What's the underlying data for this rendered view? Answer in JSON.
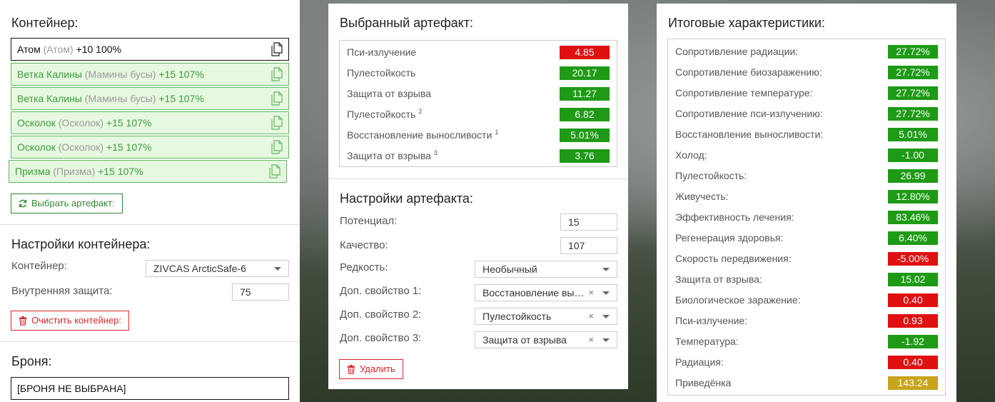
{
  "container_panel": {
    "title": "Контейнер:",
    "items": [
      {
        "name": "Атом",
        "alt": "(Атом)",
        "level": "+10 100%",
        "selected": false
      },
      {
        "name": "Ветка Калины",
        "alt": "(Мамины бусы)",
        "level": "+15 107%",
        "selected": true
      },
      {
        "name": "Ветка Калины",
        "alt": "(Мамины бусы)",
        "level": "+15 107%",
        "selected": true
      },
      {
        "name": "Осколок",
        "alt": "(Осколок)",
        "level": "+15 107%",
        "selected": true
      },
      {
        "name": "Осколок",
        "alt": "(Осколок)",
        "level": "+15 107%",
        "selected": true
      },
      {
        "name": "Призма",
        "alt": "(Призма)",
        "level": "+15 107%",
        "selected": true
      }
    ],
    "select_button": "Выбрать артефакт:",
    "settings_title": "Настройки контейнера:",
    "container_label": "Контейнер:",
    "container_value": "ZIVCAS ArcticSafe-6",
    "inner_protection_label": "Внутренняя защита:",
    "inner_protection_value": "75",
    "clear_button": "Очистить контейнер:",
    "armor_title": "Броня:",
    "armor_value": "[БРОНЯ НЕ ВЫБРАНА]"
  },
  "artifact_panel": {
    "title": "Выбранный артефакт:",
    "stats": [
      {
        "label": "Пси-излучение",
        "sup": "",
        "value": "4.85",
        "color": "red"
      },
      {
        "label": "Пулестойкость",
        "sup": "",
        "value": "20.17",
        "color": "green"
      },
      {
        "label": "Защита от взрыва",
        "sup": "",
        "value": "11.27",
        "color": "green"
      },
      {
        "label": "Пулестойкость",
        "sup": "2",
        "value": "6.82",
        "color": "green"
      },
      {
        "label": "Восстановление выносливости",
        "sup": "1",
        "value": "5.01%",
        "color": "green"
      },
      {
        "label": "Защита от взрыва",
        "sup": "3",
        "value": "3.76",
        "color": "green"
      }
    ],
    "settings_title": "Настройки артефакта:",
    "potential_label": "Потенциал:",
    "potential_value": "15",
    "quality_label": "Качество:",
    "quality_value": "107",
    "rarity_label": "Редкость:",
    "rarity_value": "Необычный",
    "extra1_label": "Доп. свойство 1:",
    "extra1_value": "Восстановление выносливости",
    "extra2_label": "Доп. свойство 2:",
    "extra2_value": "Пулестойкость",
    "extra3_label": "Доп. свойство 3:",
    "extra3_value": "Защита от взрыва",
    "clear_x": "×",
    "delete_button": "Удалить"
  },
  "totals_panel": {
    "title": "Итоговые характеристики:",
    "stats": [
      {
        "label": "Сопротивление радиации:",
        "value": "27.72%",
        "color": "green"
      },
      {
        "label": "Сопротивление биозаражению:",
        "value": "27.72%",
        "color": "green"
      },
      {
        "label": "Сопротивление температуре:",
        "value": "27.72%",
        "color": "green"
      },
      {
        "label": "Сопротивление пси-излучению:",
        "value": "27.72%",
        "color": "green"
      },
      {
        "label": "Восстановление выносливости:",
        "value": "5.01%",
        "color": "green"
      },
      {
        "label": "Холод:",
        "value": "-1.00",
        "color": "green"
      },
      {
        "label": "Пулестойкость:",
        "value": "26.99",
        "color": "green"
      },
      {
        "label": "Живучесть:",
        "value": "12.80%",
        "color": "green"
      },
      {
        "label": "Эффективность лечения:",
        "value": "83.46%",
        "color": "green"
      },
      {
        "label": "Регенерация здоровья:",
        "value": "6.40%",
        "color": "green"
      },
      {
        "label": "Скорость передвижения:",
        "value": "-5.00%",
        "color": "red"
      },
      {
        "label": "Защита от взрыва:",
        "value": "15.02",
        "color": "green"
      },
      {
        "label": "Биологическое заражение:",
        "value": "0.40",
        "color": "red"
      },
      {
        "label": "Пси-излучение:",
        "value": "0.93",
        "color": "red"
      },
      {
        "label": "Температура:",
        "value": "-1.92",
        "color": "green"
      },
      {
        "label": "Радиация:",
        "value": "0.40",
        "color": "red"
      },
      {
        "label": "Приведёнка",
        "value": "143.24",
        "color": "gold"
      }
    ]
  },
  "colors": {
    "green": "#1e9a16",
    "red": "#e01010",
    "gold": "#c8a41a",
    "accent_green": "#2e8b2e",
    "accent_red": "#d9262b"
  },
  "icons": {
    "item": "document-copy-icon",
    "select": "refresh-icon",
    "clear": "trash-icon"
  }
}
